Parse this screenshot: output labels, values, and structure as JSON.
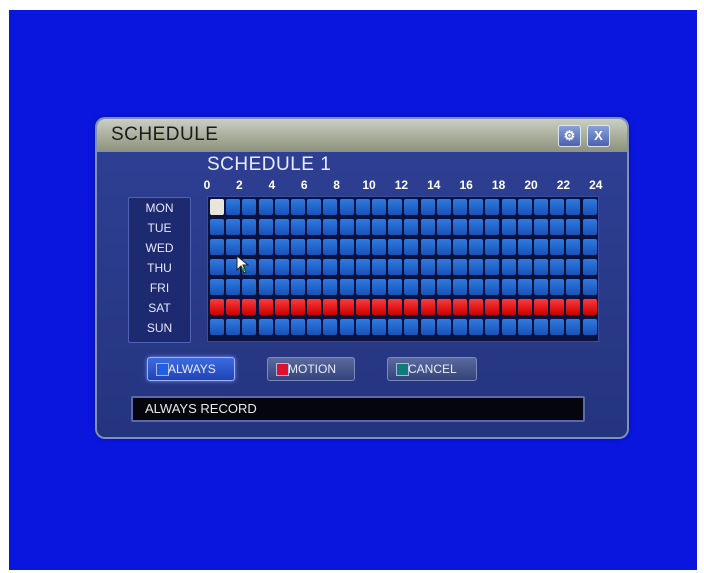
{
  "dialog": {
    "title": "SCHEDULE",
    "settings_icon": "gear-icon",
    "close_label": "X"
  },
  "schedule": {
    "label": "SCHEDULE 1",
    "hour_labels": [
      "0",
      "2",
      "4",
      "6",
      "8",
      "10",
      "12",
      "14",
      "16",
      "18",
      "20",
      "22",
      "24"
    ],
    "days": [
      "MON",
      "TUE",
      "WED",
      "THU",
      "FRI",
      "SAT",
      "SUN"
    ],
    "slots_per_day": 24,
    "day_modes": [
      "always",
      "always",
      "always",
      "always",
      "always",
      "motion",
      "always"
    ],
    "cursor_cell": {
      "day": "MON",
      "slot": 0
    }
  },
  "buttons": {
    "always": {
      "label": "ALWAYS",
      "color": "#1f5fe0",
      "selected": true
    },
    "motion": {
      "label": "MOTION",
      "color": "#e0102a",
      "selected": false
    },
    "cancel": {
      "label": "CANCEL",
      "color": "#127a78",
      "selected": false
    }
  },
  "status": {
    "text": "ALWAYS RECORD"
  },
  "colors": {
    "background": "#0a16dd",
    "always": "#2a6fd8",
    "motion": "#e01010"
  }
}
